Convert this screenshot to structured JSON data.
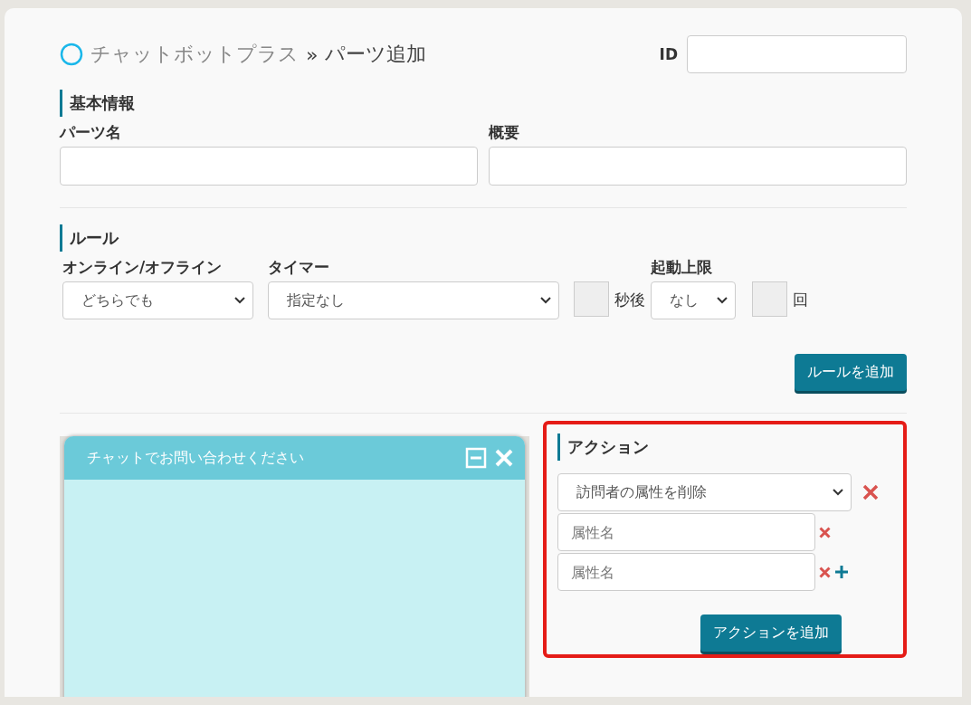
{
  "breadcrumb": {
    "site": "チャットボットプラス",
    "separator": "»",
    "page": "パーツ追加"
  },
  "id_field": {
    "label": "ID"
  },
  "basic": {
    "heading": "基本情報",
    "fields": [
      {
        "label": "パーツ名"
      },
      {
        "label": "概要"
      }
    ]
  },
  "rules": {
    "heading": "ルール",
    "online": {
      "label": "オンライン/オフライン",
      "value": "どちらでも"
    },
    "timer": {
      "label": "タイマー",
      "value": "指定なし"
    },
    "seconds_suffix": "秒後",
    "limit": {
      "label": "起動上限",
      "value": "なし"
    },
    "count_suffix": "回",
    "add_button": "ルールを追加"
  },
  "chat_preview": {
    "title": "チャットでお問い合わせください"
  },
  "actions": {
    "heading": "アクション",
    "action_select": "訪問者の属性を削除",
    "attributes": [
      {
        "placeholder": "属性名",
        "can_add": false
      },
      {
        "placeholder": "属性名",
        "can_add": true
      }
    ],
    "add_button": "アクションを追加"
  }
}
